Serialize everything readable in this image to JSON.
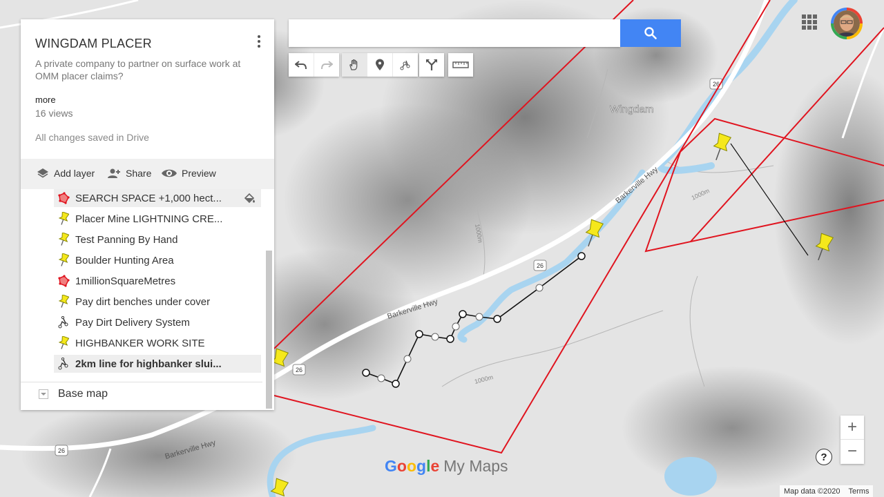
{
  "map": {
    "place_label": "Wingdam",
    "road_name": "Barkerville Hwy",
    "highway_number": "26",
    "contour_label": "1000m",
    "colors": {
      "boundary": "#e0141f",
      "river": "#a8d4f0",
      "pin": "#f5e81c"
    }
  },
  "panel": {
    "title": "WINGDAM PLACER",
    "description": "A private company to partner on surface work at OMM placer claims?",
    "more": "more",
    "views": "16 views",
    "saved": "All changes saved in Drive",
    "actions": {
      "add_layer": "Add layer",
      "share": "Share",
      "preview": "Preview"
    },
    "items": [
      {
        "label": "SEARCH SPACE +1,000 hect...",
        "icon": "polygon-icon",
        "selected": true
      },
      {
        "label": "Placer Mine LIGHTNING CRE...",
        "icon": "pushpin-icon"
      },
      {
        "label": "Test Panning By Hand",
        "icon": "pushpin-icon"
      },
      {
        "label": "Boulder Hunting Area",
        "icon": "pushpin-icon"
      },
      {
        "label": "1millionSquareMetres",
        "icon": "polygon-icon"
      },
      {
        "label": "Pay dirt benches under cover",
        "icon": "pushpin-icon"
      },
      {
        "label": "Pay Dirt Delivery System",
        "icon": "line-icon"
      },
      {
        "label": "HIGHBANKER WORK SITE",
        "icon": "pushpin-icon"
      },
      {
        "label": "2km line for highbanker slui...",
        "icon": "line-icon",
        "bold": true
      }
    ],
    "base_map": "Base map"
  },
  "search": {
    "placeholder": "",
    "value": ""
  },
  "toolbar": {
    "tools": [
      "undo-icon",
      "redo-icon",
      "hand-icon",
      "add-marker-icon",
      "draw-line-icon",
      "directions-icon",
      "measure-icon"
    ]
  },
  "controls": {
    "zoom_in": "+",
    "zoom_out": "−",
    "help": "?"
  },
  "attribution": {
    "map_data": "Map data ©2020",
    "terms": "Terms"
  },
  "branding": {
    "google": "Google",
    "my_maps": "My Maps"
  }
}
